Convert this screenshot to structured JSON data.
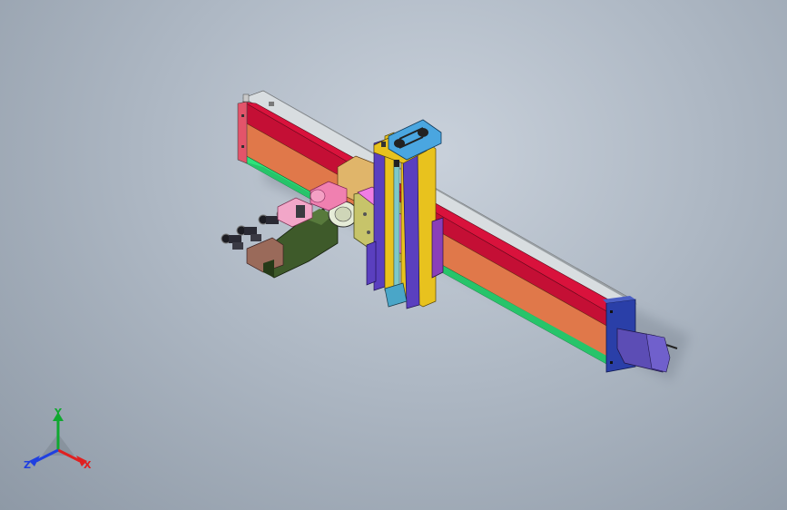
{
  "colors": {
    "background_top": "#c9d1db",
    "background_bottom": "#8e99a6",
    "rail_red": "#d9123c",
    "rail_orange": "#e0784a",
    "rail_green": "#2ee37a",
    "rail_silver": "#d8dde0",
    "endcap_blue": "#2a3fa8",
    "motor_purple": "#5c4db5",
    "column_yellow": "#e8c21e",
    "column_purple": "#5a3fbf",
    "plate_olive": "#c7c46a",
    "bracket_pink": "#f07ee3",
    "gripper_green": "#3e5a2a",
    "motor_pink": "#f2a6c8"
  },
  "triad": {
    "x_label": "X",
    "y_label": "Y",
    "z_label": "Z",
    "x_color": "#e02020",
    "y_color": "#10a830",
    "z_color": "#2040e0"
  }
}
